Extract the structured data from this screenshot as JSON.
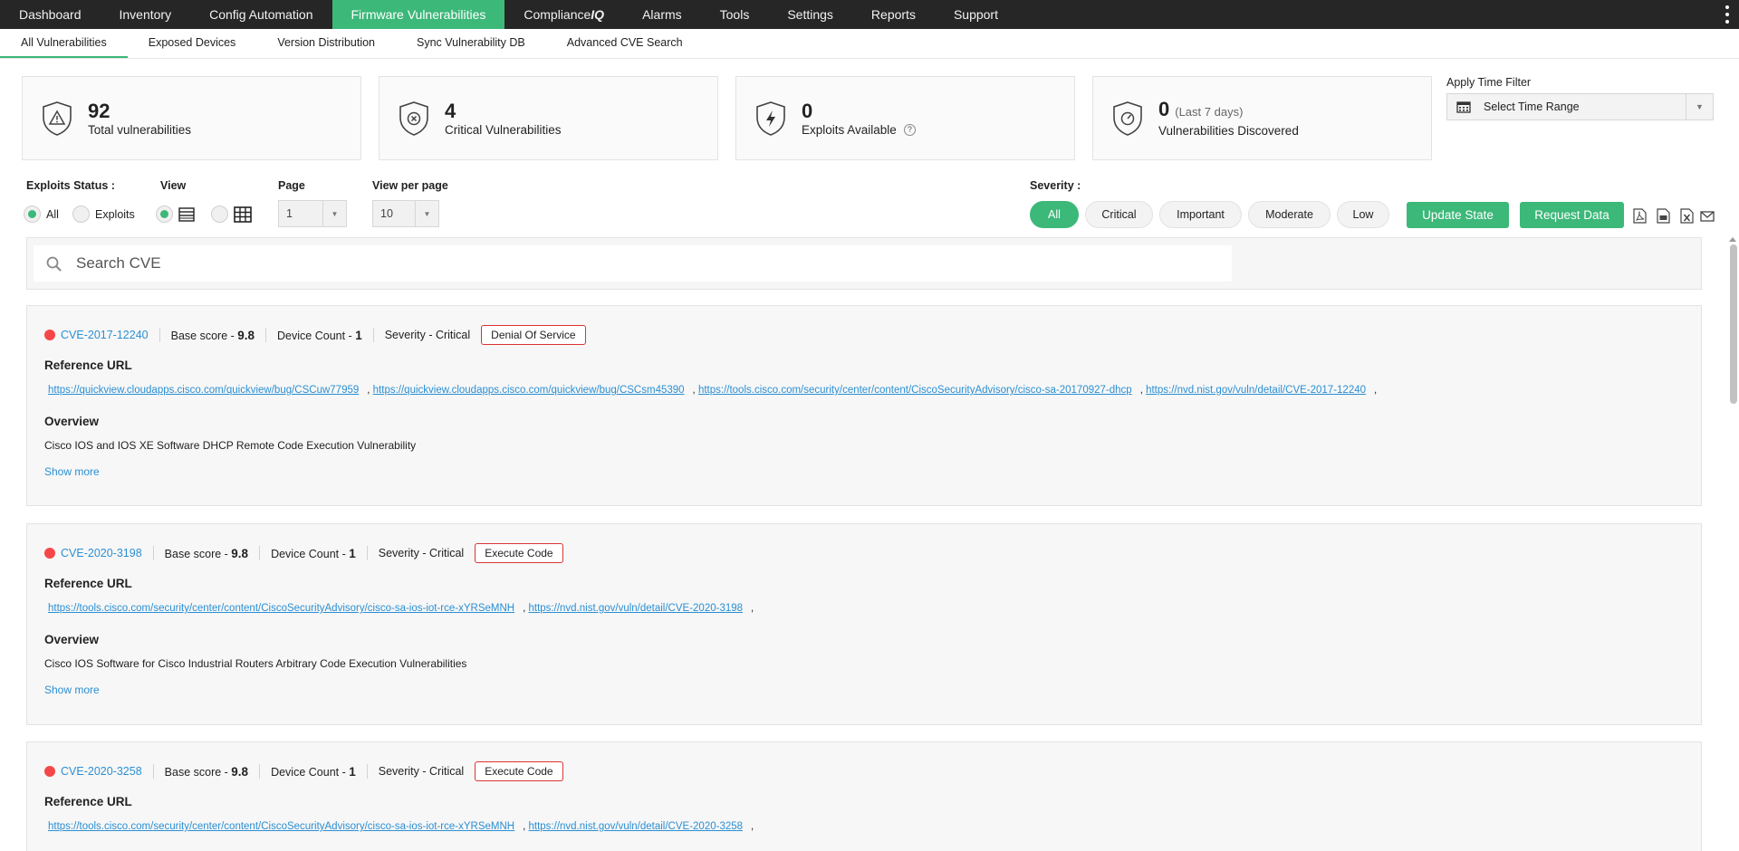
{
  "topnav": {
    "tabs": [
      {
        "label": "Dashboard",
        "active": false
      },
      {
        "label": "Inventory",
        "active": false
      },
      {
        "label": "Config Automation",
        "active": false
      },
      {
        "label": "Firmware Vulnerabilities",
        "active": true
      },
      {
        "label": "Compliance",
        "suffix": "IQ",
        "active": false
      },
      {
        "label": "Alarms",
        "active": false
      },
      {
        "label": "Tools",
        "active": false
      },
      {
        "label": "Settings",
        "active": false
      },
      {
        "label": "Reports",
        "active": false
      },
      {
        "label": "Support",
        "active": false
      }
    ]
  },
  "subnav": {
    "tabs": [
      {
        "label": "All Vulnerabilities",
        "active": true
      },
      {
        "label": "Exposed Devices",
        "active": false
      },
      {
        "label": "Version Distribution",
        "active": false
      },
      {
        "label": "Sync Vulnerability DB",
        "active": false
      },
      {
        "label": "Advanced CVE Search",
        "active": false
      }
    ]
  },
  "stats": [
    {
      "value": "92",
      "label": "Total vulnerabilities",
      "icon": "warning-shield-icon"
    },
    {
      "value": "4",
      "label": "Critical Vulnerabilities",
      "icon": "x-shield-icon"
    },
    {
      "value": "0",
      "label": "Exploits Available",
      "icon": "bolt-shield-icon",
      "help": "?"
    },
    {
      "value": "0",
      "note": "(Last 7 days)",
      "label": "Vulnerabilities Discovered",
      "icon": "gauge-shield-icon"
    }
  ],
  "time_filter": {
    "label": "Apply Time Filter",
    "value": "Select Time Range"
  },
  "filters": {
    "exploits_status_label": "Exploits Status :",
    "radio_all": "All",
    "radio_exploits": "Exploits",
    "view_label": "View",
    "page_label": "Page",
    "page_value": "1",
    "per_page_label": "View per page",
    "per_page_value": "10",
    "severity_label": "Severity :",
    "severity_options": [
      "All",
      "Critical",
      "Important",
      "Moderate",
      "Low"
    ],
    "severity_selected": "All",
    "update_state": "Update State",
    "request_data": "Request Data"
  },
  "search": {
    "placeholder": "Search CVE"
  },
  "labels": {
    "base_score": "Base score - ",
    "device_count": "Device Count - ",
    "reference_url": "Reference URL",
    "overview": "Overview",
    "show_more": "Show more"
  },
  "cves": [
    {
      "id": "CVE-2017-12240",
      "base_score": "9.8",
      "device_count": "1",
      "severity": "Severity - Critical",
      "tag": "Denial Of Service",
      "links": [
        "https://quickview.cloudapps.cisco.com/quickview/bug/CSCuw77959",
        "https://quickview.cloudapps.cisco.com/quickview/bug/CSCsm45390",
        "https://tools.cisco.com/security/center/content/CiscoSecurityAdvisory/cisco-sa-20170927-dhcp",
        "https://nvd.nist.gov/vuln/detail/CVE-2017-12240"
      ],
      "overview": "Cisco IOS and IOS XE Software DHCP Remote Code Execution Vulnerability"
    },
    {
      "id": "CVE-2020-3198",
      "base_score": "9.8",
      "device_count": "1",
      "severity": "Severity - Critical",
      "tag": "Execute Code",
      "links": [
        "https://tools.cisco.com/security/center/content/CiscoSecurityAdvisory/cisco-sa-ios-iot-rce-xYRSeMNH",
        "https://nvd.nist.gov/vuln/detail/CVE-2020-3198"
      ],
      "overview": "Cisco IOS Software for Cisco Industrial Routers Arbitrary Code Execution Vulnerabilities"
    },
    {
      "id": "CVE-2020-3258",
      "base_score": "9.8",
      "device_count": "1",
      "severity": "Severity - Critical",
      "tag": "Execute Code",
      "links": [
        "https://tools.cisco.com/security/center/content/CiscoSecurityAdvisory/cisco-sa-ios-iot-rce-xYRSeMNH",
        "https://nvd.nist.gov/vuln/detail/CVE-2020-3258"
      ],
      "overview": ""
    }
  ],
  "colors": {
    "accent": "#3cb879",
    "nav_bg": "#262626",
    "link": "#2b8fd3",
    "critical_dot": "#f44848",
    "tag_border": "#dd3333"
  }
}
